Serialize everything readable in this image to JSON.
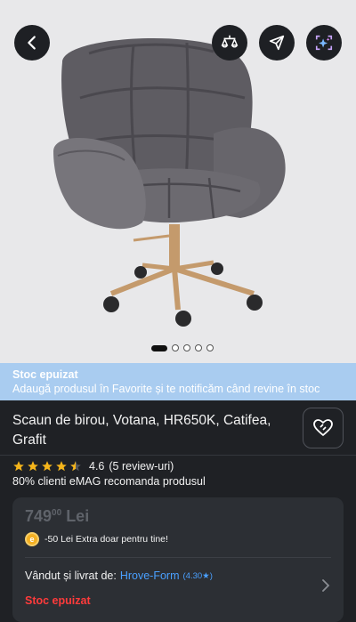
{
  "gallery": {
    "image_alt": "Scaun de birou gri cu picior auriu",
    "dots_total": 5,
    "active_dot": 1
  },
  "header": {
    "back_icon": "chevron-left-icon",
    "compare_icon": "compare-icon",
    "share_icon": "share-icon",
    "ai_icon": "ai-sparkle-icon"
  },
  "banner": {
    "title": "Stoc epuizat",
    "message": "Adaugă produsul în Favorite și te notificăm când revine în stoc",
    "background": "#a9ccf0"
  },
  "product": {
    "title": "Scaun de birou, Votana, HR650K, Catifea, Grafit",
    "rating": "4.6",
    "stars": 4.5,
    "reviews": "(5 review-uri)",
    "recommend": "80% clienti eMAG recomanda produsul"
  },
  "price_card": {
    "price_int": "749",
    "price_dec": "00",
    "currency": "Lei",
    "promo": "-50 Lei Extra doar pentru tine!",
    "seller_label": "Vândut și livrat de:",
    "seller_name": "Hrove-Form",
    "seller_score": "(4.30",
    "seller_star": "★)",
    "stock_status": "Stoc epuizat",
    "status_color": "#ff3b3b",
    "link_color": "#4aa0ff"
  }
}
